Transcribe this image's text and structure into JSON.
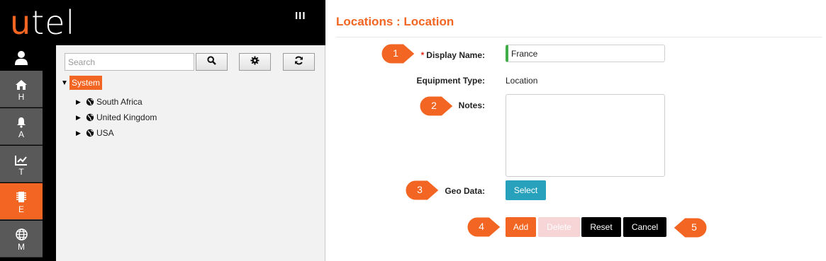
{
  "brand": {
    "logo_letter": "u",
    "logo_rest": "tel"
  },
  "topbar": {
    "menu_toggle_label": "III"
  },
  "rail": {
    "items": [
      {
        "label": "H",
        "icon": "home-icon",
        "active": false
      },
      {
        "label": "A",
        "icon": "bell-icon",
        "active": false
      },
      {
        "label": "T",
        "icon": "trend-chart-icon",
        "active": false
      },
      {
        "label": "E",
        "icon": "chip-icon",
        "active": true
      },
      {
        "label": "M",
        "icon": "globe-icon",
        "active": false
      }
    ]
  },
  "tree": {
    "search_placeholder": "Search",
    "root": "System",
    "children": [
      "South Africa",
      "United Kingdom",
      "USA"
    ]
  },
  "form": {
    "title": "Locations : Location",
    "display_name_label": "Display Name:",
    "required_marker": "*",
    "display_name_value": "France",
    "equipment_type_label": "Equipment Type:",
    "equipment_type_value": "Location",
    "notes_label": "Notes:",
    "notes_value": "",
    "geo_data_label": "Geo Data:",
    "select_label": "Select",
    "actions": {
      "add": "Add",
      "delete": "Delete",
      "reset": "Reset",
      "cancel": "Cancel"
    }
  },
  "callouts": [
    "1",
    "2",
    "3",
    "4",
    "5"
  ],
  "colors": {
    "accent": "#f26522",
    "teal": "#28a1bd",
    "valid": "#3fae49",
    "rail": "#595959"
  }
}
